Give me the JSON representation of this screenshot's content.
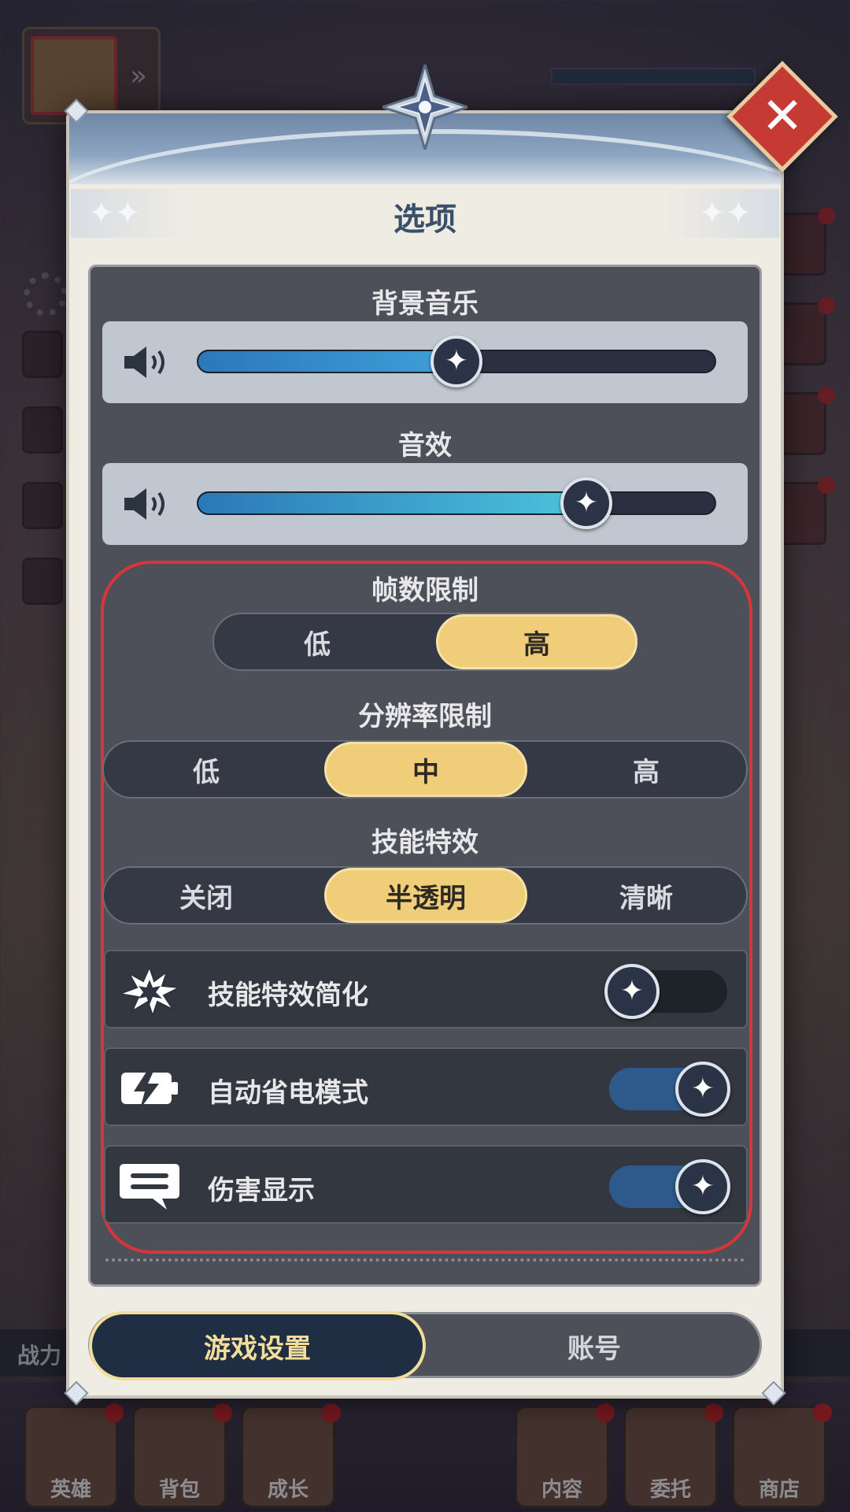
{
  "dialog": {
    "title": "选项",
    "close_icon": "close-x-icon"
  },
  "audio": {
    "music": {
      "label": "背景音乐",
      "value": 0.5
    },
    "sfx": {
      "label": "音效",
      "value": 0.75
    }
  },
  "frame_limit": {
    "label": "帧数限制",
    "options": [
      "低",
      "高"
    ],
    "selected": "高"
  },
  "resolution_limit": {
    "label": "分辨率限制",
    "options": [
      "低",
      "中",
      "高"
    ],
    "selected": "中"
  },
  "skill_effects": {
    "label": "技能特效",
    "options": [
      "关闭",
      "半透明",
      "清晰"
    ],
    "selected": "半透明"
  },
  "toggles": [
    {
      "label": "技能特效简化",
      "on": false,
      "icon": "burst-icon"
    },
    {
      "label": "自动省电模式",
      "on": true,
      "icon": "battery-bolt-icon"
    },
    {
      "label": "伤害显示",
      "on": true,
      "icon": "chat-bubble-icon"
    }
  ],
  "tabs": {
    "game_settings": "游戏设置",
    "account": "账号",
    "active": "game_settings"
  },
  "background_hud": {
    "power_label": "战力",
    "bottom_nav": [
      "英雄",
      "背包",
      "成长",
      "内容",
      "委托",
      "商店"
    ]
  },
  "colors": {
    "accent_gold": "#f0cd78",
    "toggle_on": "#2d5a8a",
    "highlight_outline": "#d8353a",
    "close_red": "#c53a33"
  }
}
